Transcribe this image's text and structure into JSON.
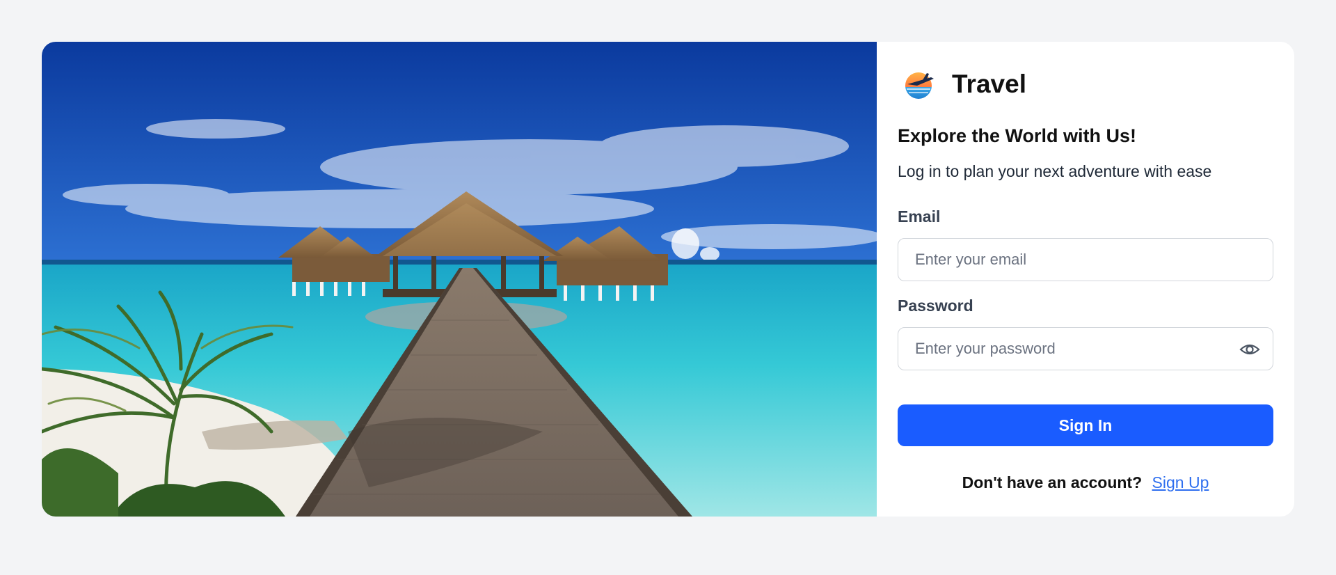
{
  "brand": {
    "name": "Travel",
    "logo_icon": "plane-sunset-logo"
  },
  "heading": "Explore the World with Us!",
  "subheading": "Log in to plan your next adventure with ease",
  "form": {
    "email_label": "Email",
    "email_placeholder": "Enter your email",
    "email_value": "",
    "password_label": "Password",
    "password_placeholder": "Enter your password",
    "password_value": "",
    "password_toggle_icon": "eye-icon",
    "submit_label": "Sign In"
  },
  "footer": {
    "prompt": "Don't have an account?",
    "link_label": "Sign Up"
  },
  "colors": {
    "primary": "#1a5cff",
    "link": "#2f6fef",
    "background": "#f3f4f6"
  }
}
